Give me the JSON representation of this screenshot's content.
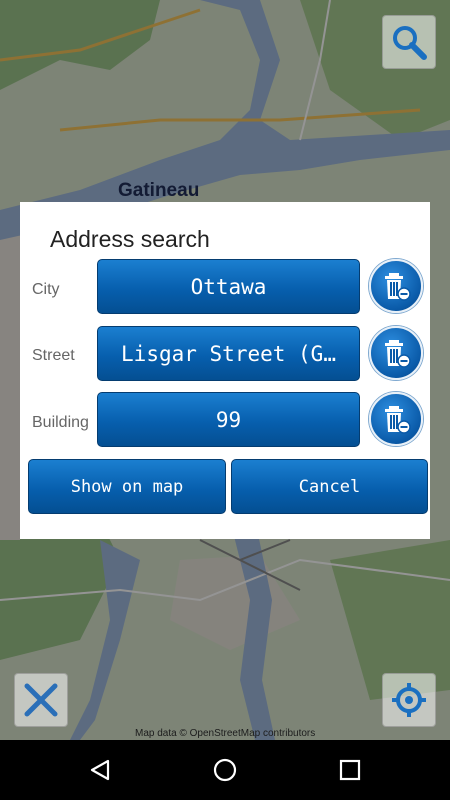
{
  "map": {
    "place_label": "Gatineau",
    "attribution": "Map data © OpenStreetMap contributors"
  },
  "dialog": {
    "title": "Address search",
    "rows": [
      {
        "label": "City",
        "value": "Ottawa"
      },
      {
        "label": "Street",
        "value": "Lisgar Street (G…"
      },
      {
        "label": "Building",
        "value": "99"
      }
    ],
    "show_on_map_label": "Show on map",
    "cancel_label": "Cancel"
  },
  "icons": {
    "search": "magnifier-icon",
    "clear": "trash-minus-icon",
    "measure": "ruler-pencil-icon",
    "locate": "crosshair-icon",
    "back": "back-triangle-icon",
    "home": "home-circle-icon",
    "recent": "recent-square-icon"
  },
  "colors": {
    "button_blue": "#075fae",
    "button_text": "#ffffff",
    "dialog_bg": "#ffffff",
    "label_gray": "#666666"
  }
}
